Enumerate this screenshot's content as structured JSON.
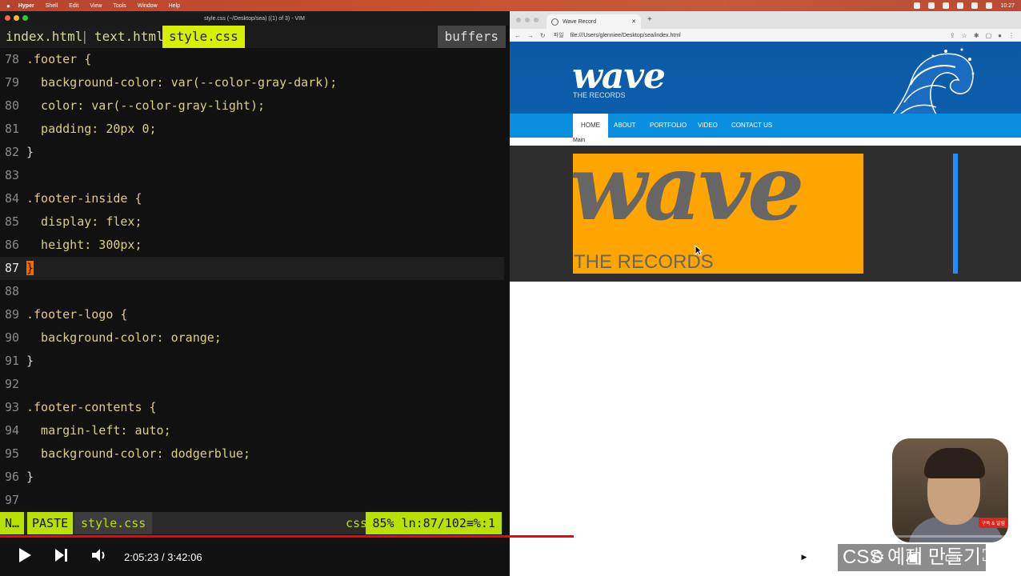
{
  "menubar": {
    "app": "Hyper",
    "items": [
      "Shell",
      "Edit",
      "View",
      "Tools",
      "Window",
      "Help"
    ],
    "clock": "10:27"
  },
  "terminal": {
    "title": "style.css (~/Desktop/sea) ((1) of 3) - VIM",
    "tabs": [
      "index.html",
      "|",
      "text.html",
      "style.css"
    ],
    "buffers_label": "buffers",
    "lines": [
      {
        "n": "78",
        "code": ".footer {"
      },
      {
        "n": "79",
        "code": "  background-color: var(--color-gray-dark);"
      },
      {
        "n": "80",
        "code": "  color: var(--color-gray-light);"
      },
      {
        "n": "81",
        "code": "  padding: 20px 0;"
      },
      {
        "n": "82",
        "code": "}"
      },
      {
        "n": "83",
        "code": ""
      },
      {
        "n": "84",
        "code": ".footer-inside {"
      },
      {
        "n": "85",
        "code": "  display: flex;"
      },
      {
        "n": "86",
        "code": "  height: 300px;"
      },
      {
        "n": "87",
        "code": "}"
      },
      {
        "n": "88",
        "code": ""
      },
      {
        "n": "89",
        "code": ".footer-logo {"
      },
      {
        "n": "90",
        "code": "  background-color: orange;"
      },
      {
        "n": "91",
        "code": "}"
      },
      {
        "n": "92",
        "code": ""
      },
      {
        "n": "93",
        "code": ".footer-contents {"
      },
      {
        "n": "94",
        "code": "  margin-left: auto;"
      },
      {
        "n": "95",
        "code": "  background-color: dodgerblue;"
      },
      {
        "n": "96",
        "code": "}"
      },
      {
        "n": "97",
        "code": ""
      }
    ],
    "status": {
      "mode": "N…",
      "paste": "PASTE",
      "file": "style.css",
      "filetype": "css",
      "position": "85%  ln:87/102≡%:1"
    }
  },
  "browser": {
    "tab_title": "Wave Record",
    "url_label": "파일",
    "url": "file:///Users/glenniee/Desktop/sea/index.html",
    "site": {
      "logo": "wave",
      "tagline": "THE RECORDS",
      "nav": [
        "HOME",
        "ABOUT",
        "PORTFOLIO",
        "VIDEO",
        "CONTACT US"
      ],
      "main_label": "Main",
      "footer_logo_word": "wave",
      "footer_logo_sub": "THE RECORDS"
    }
  },
  "player": {
    "time": "2:05:23 / 3:42:06",
    "watermark": "CSS 예제 만들기",
    "progress_fraction": 0.562,
    "subscribe_badge": "구독 & 알림"
  }
}
